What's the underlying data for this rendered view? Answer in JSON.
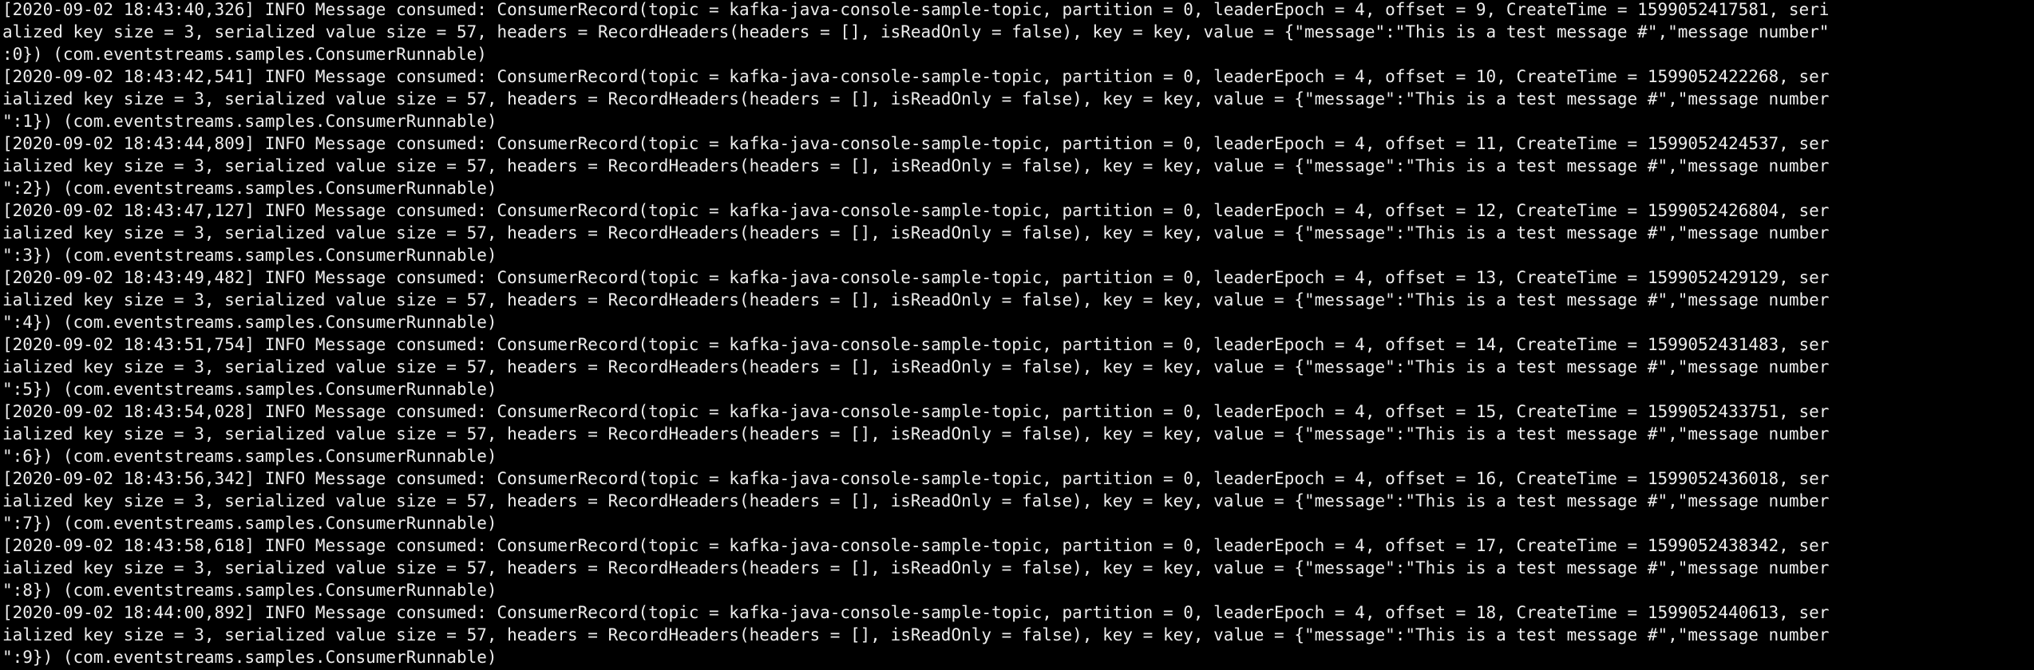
{
  "terminal": {
    "background": "#000000",
    "foreground": "#ededed",
    "lines": [
      "[2020-09-02 18:43:40,326] INFO Message consumed: ConsumerRecord(topic = kafka-java-console-sample-topic, partition = 0, leaderEpoch = 4, offset = 9, CreateTime = 1599052417581, seri",
      "alized key size = 3, serialized value size = 57, headers = RecordHeaders(headers = [], isReadOnly = false), key = key, value = {\"message\":\"This is a test message #\",\"message number\"",
      ":0}) (com.eventstreams.samples.ConsumerRunnable)",
      "[2020-09-02 18:43:42,541] INFO Message consumed: ConsumerRecord(topic = kafka-java-console-sample-topic, partition = 0, leaderEpoch = 4, offset = 10, CreateTime = 1599052422268, ser",
      "ialized key size = 3, serialized value size = 57, headers = RecordHeaders(headers = [], isReadOnly = false), key = key, value = {\"message\":\"This is a test message #\",\"message number",
      "\":1}) (com.eventstreams.samples.ConsumerRunnable)",
      "[2020-09-02 18:43:44,809] INFO Message consumed: ConsumerRecord(topic = kafka-java-console-sample-topic, partition = 0, leaderEpoch = 4, offset = 11, CreateTime = 1599052424537, ser",
      "ialized key size = 3, serialized value size = 57, headers = RecordHeaders(headers = [], isReadOnly = false), key = key, value = {\"message\":\"This is a test message #\",\"message number",
      "\":2}) (com.eventstreams.samples.ConsumerRunnable)",
      "[2020-09-02 18:43:47,127] INFO Message consumed: ConsumerRecord(topic = kafka-java-console-sample-topic, partition = 0, leaderEpoch = 4, offset = 12, CreateTime = 1599052426804, ser",
      "ialized key size = 3, serialized value size = 57, headers = RecordHeaders(headers = [], isReadOnly = false), key = key, value = {\"message\":\"This is a test message #\",\"message number",
      "\":3}) (com.eventstreams.samples.ConsumerRunnable)",
      "[2020-09-02 18:43:49,482] INFO Message consumed: ConsumerRecord(topic = kafka-java-console-sample-topic, partition = 0, leaderEpoch = 4, offset = 13, CreateTime = 1599052429129, ser",
      "ialized key size = 3, serialized value size = 57, headers = RecordHeaders(headers = [], isReadOnly = false), key = key, value = {\"message\":\"This is a test message #\",\"message number",
      "\":4}) (com.eventstreams.samples.ConsumerRunnable)",
      "[2020-09-02 18:43:51,754] INFO Message consumed: ConsumerRecord(topic = kafka-java-console-sample-topic, partition = 0, leaderEpoch = 4, offset = 14, CreateTime = 1599052431483, ser",
      "ialized key size = 3, serialized value size = 57, headers = RecordHeaders(headers = [], isReadOnly = false), key = key, value = {\"message\":\"This is a test message #\",\"message number",
      "\":5}) (com.eventstreams.samples.ConsumerRunnable)",
      "[2020-09-02 18:43:54,028] INFO Message consumed: ConsumerRecord(topic = kafka-java-console-sample-topic, partition = 0, leaderEpoch = 4, offset = 15, CreateTime = 1599052433751, ser",
      "ialized key size = 3, serialized value size = 57, headers = RecordHeaders(headers = [], isReadOnly = false), key = key, value = {\"message\":\"This is a test message #\",\"message number",
      "\":6}) (com.eventstreams.samples.ConsumerRunnable)",
      "[2020-09-02 18:43:56,342] INFO Message consumed: ConsumerRecord(topic = kafka-java-console-sample-topic, partition = 0, leaderEpoch = 4, offset = 16, CreateTime = 1599052436018, ser",
      "ialized key size = 3, serialized value size = 57, headers = RecordHeaders(headers = [], isReadOnly = false), key = key, value = {\"message\":\"This is a test message #\",\"message number",
      "\":7}) (com.eventstreams.samples.ConsumerRunnable)",
      "[2020-09-02 18:43:58,618] INFO Message consumed: ConsumerRecord(topic = kafka-java-console-sample-topic, partition = 0, leaderEpoch = 4, offset = 17, CreateTime = 1599052438342, ser",
      "ialized key size = 3, serialized value size = 57, headers = RecordHeaders(headers = [], isReadOnly = false), key = key, value = {\"message\":\"This is a test message #\",\"message number",
      "\":8}) (com.eventstreams.samples.ConsumerRunnable)",
      "[2020-09-02 18:44:00,892] INFO Message consumed: ConsumerRecord(topic = kafka-java-console-sample-topic, partition = 0, leaderEpoch = 4, offset = 18, CreateTime = 1599052440613, ser",
      "ialized key size = 3, serialized value size = 57, headers = RecordHeaders(headers = [], isReadOnly = false), key = key, value = {\"message\":\"This is a test message #\",\"message number",
      "\":9}) (com.eventstreams.samples.ConsumerRunnable)"
    ]
  }
}
